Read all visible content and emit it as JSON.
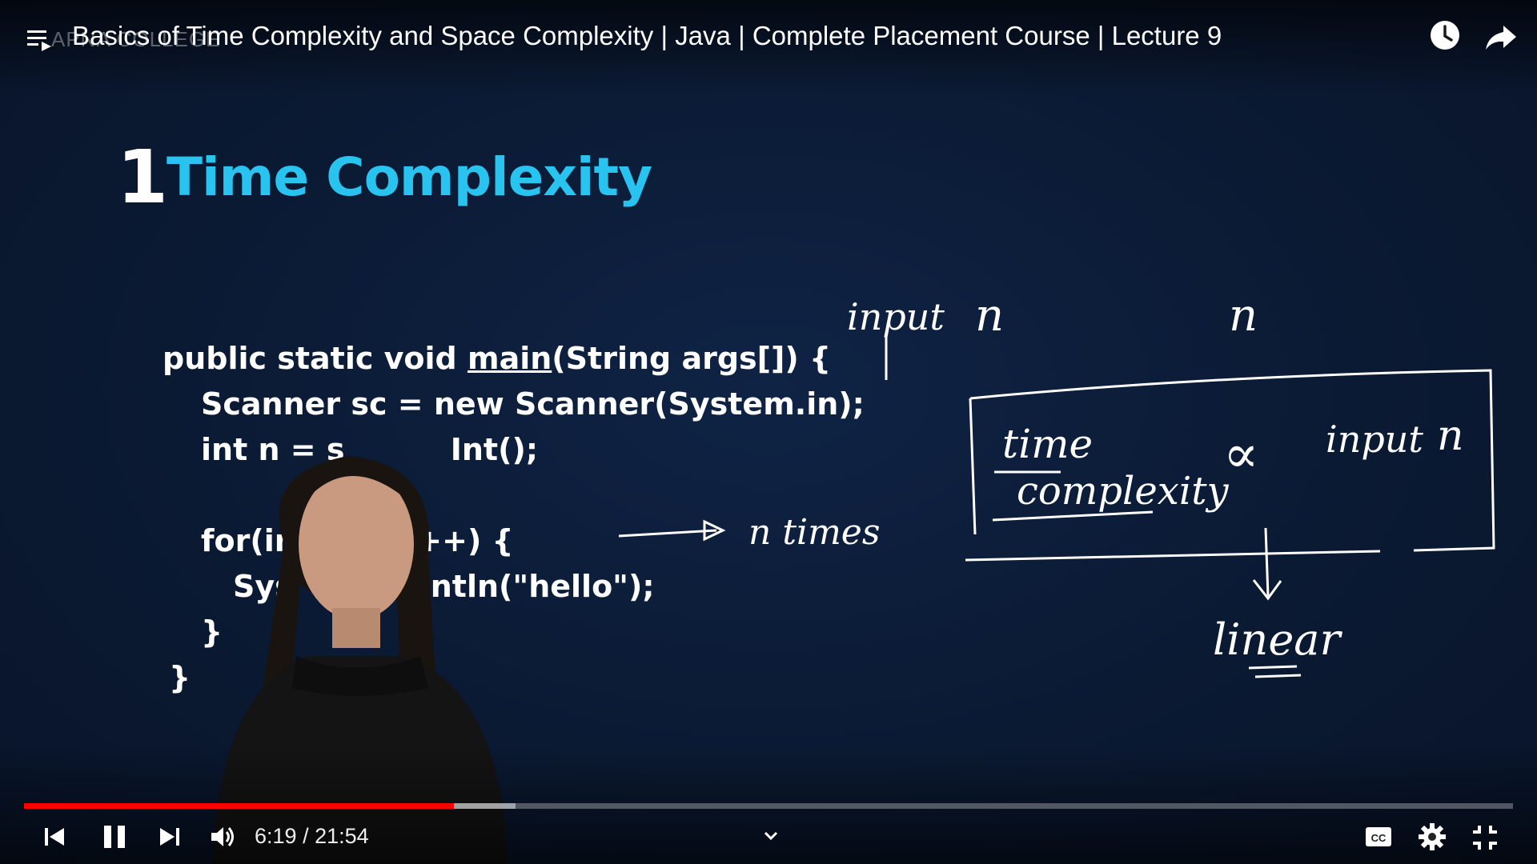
{
  "header": {
    "title": "Basics of Time Complexity and Space Complexity | Java | Complete Placement Course | Lecture 9",
    "channel_watermark": "APNA COLLEGE"
  },
  "slide": {
    "number": "1",
    "title": "Time Complexity",
    "code": {
      "line1_pre": "public static void ",
      "line1_main": "main",
      "line1_post": "(String args[]) {",
      "line2": "Scanner sc = new Scanner(System.in);",
      "line3": "int n = s          Int(); ",
      "line4": "for(int          ++) {",
      "line5": "Sys             ntln(\"hello\");",
      "line6": "}",
      "line7": "}"
    }
  },
  "annotations": {
    "input_label": "input",
    "n1": "n",
    "n2": "n",
    "n_times": "n times",
    "box_time": "time",
    "box_complexity": "complexity",
    "proportional": "∝",
    "box_input": "input",
    "box_n": "n",
    "linear": "linear"
  },
  "player": {
    "current_time": "6:19",
    "separator": " / ",
    "duration": "21:54",
    "progress_fraction": 0.2887,
    "buffered_fraction": 0.33,
    "accent_color": "#ff0000"
  },
  "icons": {
    "playlist": "playlist-icon",
    "watch_later": "clock-icon",
    "share": "share-icon",
    "previous": "previous-icon",
    "pause": "pause-icon",
    "next": "next-icon",
    "volume": "volume-icon",
    "captions": "cc-icon",
    "settings": "gear-icon",
    "exit_fullscreen": "exit-fullscreen-icon",
    "expand": "chevron-down-icon"
  }
}
